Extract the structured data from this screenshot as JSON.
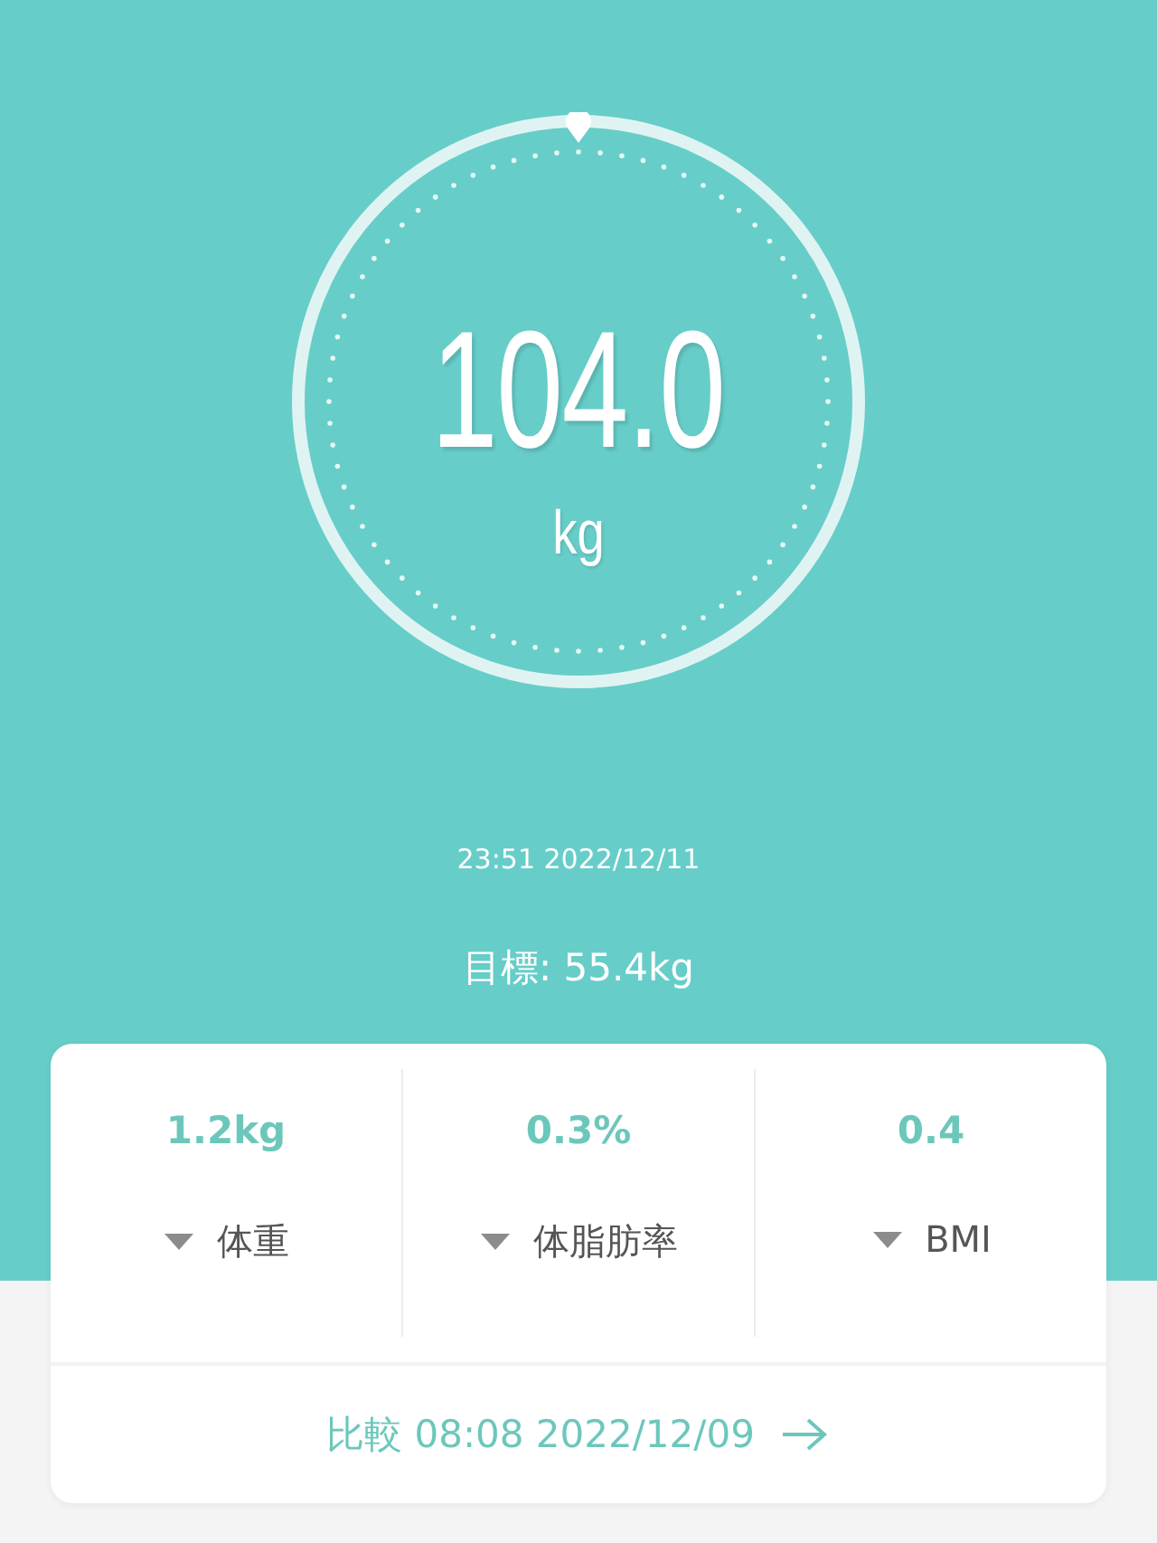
{
  "gauge": {
    "value": "104.0",
    "unit": "kg"
  },
  "measured_at": "23:51 2022/12/11",
  "target": "目標: 55.4kg",
  "changes": [
    {
      "value": "1.2kg",
      "label": "体重",
      "decreased": true
    },
    {
      "value": "0.3%",
      "label": "体脂肪率",
      "decreased": true
    },
    {
      "value": "0.4",
      "label": "BMI",
      "decreased": true
    }
  ],
  "compare": {
    "label": "比較 08:08 2022/12/09"
  }
}
